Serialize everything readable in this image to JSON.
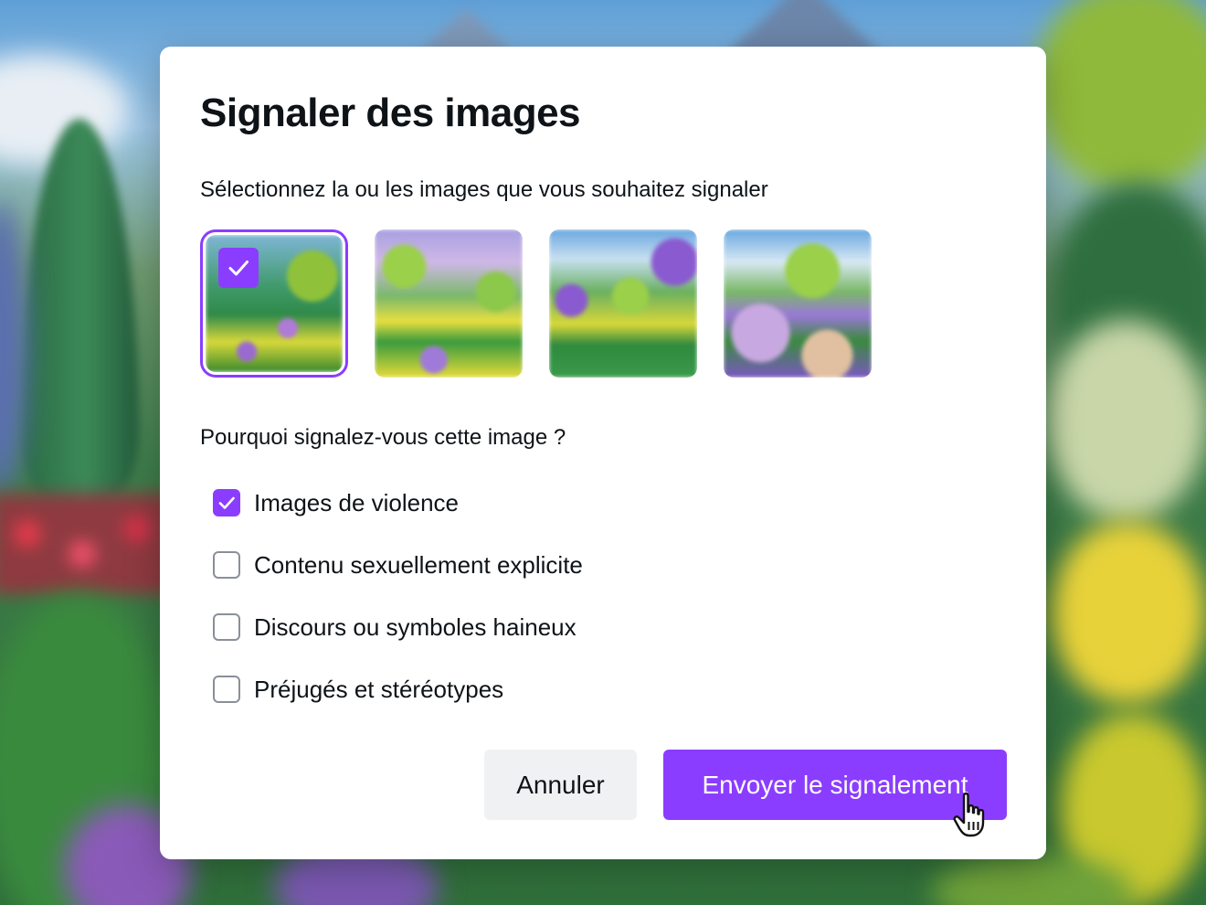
{
  "dialog": {
    "title": "Signaler des images",
    "subtitle": "Sélectionnez la ou les images que vous souhaitez signaler",
    "question": "Pourquoi signalez-vous cette image ?",
    "images": [
      {
        "icon": "garden-thumbnail",
        "selected": true
      },
      {
        "icon": "garden-thumbnail",
        "selected": false
      },
      {
        "icon": "garden-thumbnail",
        "selected": false
      },
      {
        "icon": "garden-thumbnail",
        "selected": false
      }
    ],
    "options": [
      {
        "label": "Images de violence",
        "checked": true
      },
      {
        "label": "Contenu sexuellement explicite",
        "checked": false
      },
      {
        "label": "Discours ou symboles haineux",
        "checked": false
      },
      {
        "label": "Préjugés et stéréotypes",
        "checked": false
      }
    ],
    "cancel_label": "Annuler",
    "submit_label": "Envoyer le signalement"
  },
  "colors": {
    "accent": "#8b3dff",
    "cancel_bg": "#f0f1f3",
    "text": "#0e1318"
  }
}
